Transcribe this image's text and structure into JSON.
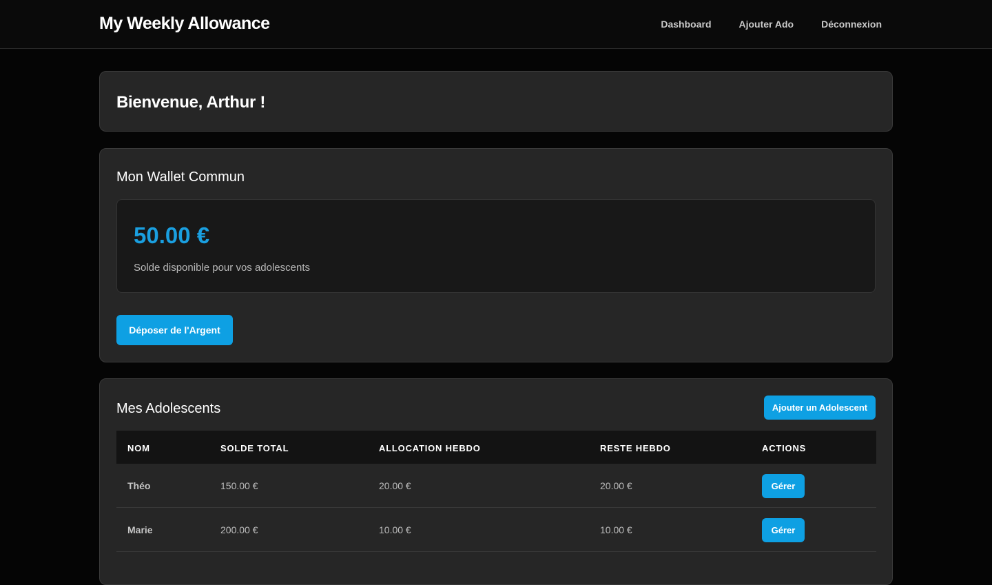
{
  "header": {
    "brand": "My Weekly Allowance",
    "nav": [
      "Dashboard",
      "Ajouter Ado",
      "Déconnexion"
    ]
  },
  "welcome": {
    "title": "Bienvenue, Arthur !"
  },
  "wallet": {
    "title": "Mon Wallet Commun",
    "amount": "50.00 €",
    "subtitle": "Solde disponible pour vos adolescents",
    "deposit_label": "Déposer de l'Argent"
  },
  "teens": {
    "title": "Mes Adolescents",
    "add_label": "Ajouter un Adolescent",
    "columns": [
      "Nom",
      "Solde Total",
      "Allocation Hebdo",
      "Reste Hebdo",
      "Actions"
    ],
    "rows": [
      {
        "name": "Théo",
        "balance": "150.00 €",
        "allowance": "20.00 €",
        "remaining": "20.00 €",
        "action": "Gérer"
      },
      {
        "name": "Marie",
        "balance": "200.00 €",
        "allowance": "10.00 €",
        "remaining": "10.00 €",
        "action": "Gérer"
      }
    ]
  },
  "colors": {
    "accent": "#0ea0e3",
    "amount": "#1a9fe0",
    "background": "#050505",
    "card": "#262626"
  }
}
